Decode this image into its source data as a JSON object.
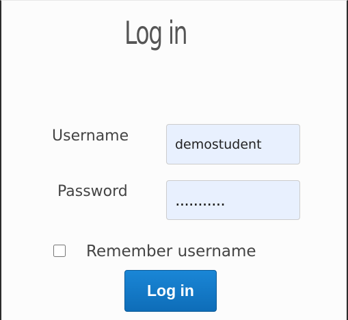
{
  "login_form": {
    "title": "Log in",
    "username_label": "Username",
    "username_value": "demostudent",
    "password_label": "Password",
    "password_value": "...........",
    "remember_label": "Remember username",
    "remember_checked": false,
    "submit_label": "Log in"
  },
  "colors": {
    "field_background": "#e8f0fe",
    "button_background": "#1177c6",
    "button_text": "#ffffff",
    "panel_border": "#2c2c2c"
  }
}
